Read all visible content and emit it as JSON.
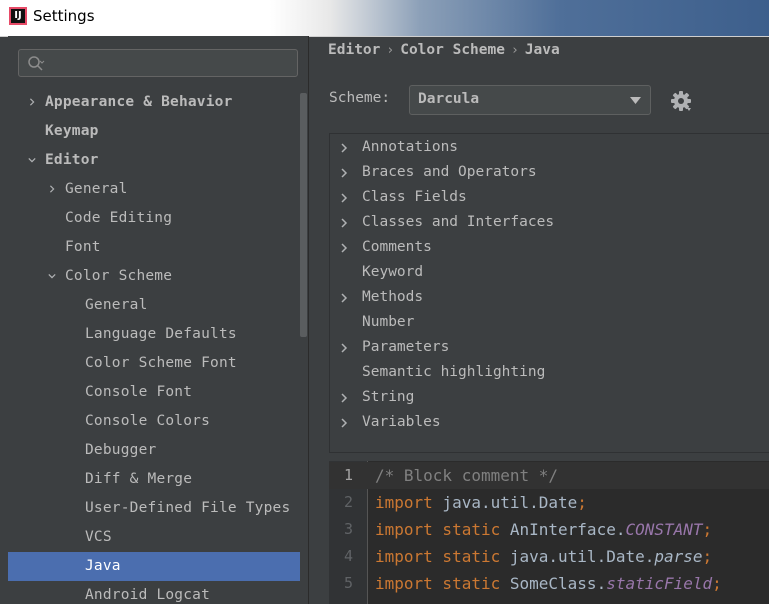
{
  "window": {
    "title": "Settings",
    "app_icon_text": "IJ"
  },
  "sidebar": {
    "search_placeholder": "",
    "items": [
      {
        "label": "Appearance & Behavior",
        "bold": true,
        "arrow": "right",
        "level": 0
      },
      {
        "label": "Keymap",
        "bold": true,
        "arrow": "none",
        "level": 0
      },
      {
        "label": "Editor",
        "bold": true,
        "arrow": "down",
        "level": 0
      },
      {
        "label": "General",
        "bold": false,
        "arrow": "right",
        "level": 1
      },
      {
        "label": "Code Editing",
        "bold": false,
        "arrow": "none",
        "level": 1
      },
      {
        "label": "Font",
        "bold": false,
        "arrow": "none",
        "level": 1
      },
      {
        "label": "Color Scheme",
        "bold": false,
        "arrow": "down",
        "level": 1
      },
      {
        "label": "General",
        "bold": false,
        "arrow": "none",
        "level": 2
      },
      {
        "label": "Language Defaults",
        "bold": false,
        "arrow": "none",
        "level": 2
      },
      {
        "label": "Color Scheme Font",
        "bold": false,
        "arrow": "none",
        "level": 2
      },
      {
        "label": "Console Font",
        "bold": false,
        "arrow": "none",
        "level": 2
      },
      {
        "label": "Console Colors",
        "bold": false,
        "arrow": "none",
        "level": 2
      },
      {
        "label": "Debugger",
        "bold": false,
        "arrow": "none",
        "level": 2
      },
      {
        "label": "Diff & Merge",
        "bold": false,
        "arrow": "none",
        "level": 2
      },
      {
        "label": "User-Defined File Types",
        "bold": false,
        "arrow": "none",
        "level": 2
      },
      {
        "label": "VCS",
        "bold": false,
        "arrow": "none",
        "level": 2
      },
      {
        "label": "Java",
        "bold": false,
        "arrow": "none",
        "level": 2,
        "selected": true
      },
      {
        "label": "Android Logcat",
        "bold": false,
        "arrow": "none",
        "level": 2
      }
    ]
  },
  "breadcrumb": {
    "items": [
      "Editor",
      "Color Scheme",
      "Java"
    ],
    "separator": "›"
  },
  "scheme": {
    "label": "Scheme:",
    "value": "Darcula"
  },
  "categories": [
    {
      "label": "Annotations",
      "expandable": true
    },
    {
      "label": "Braces and Operators",
      "expandable": true
    },
    {
      "label": "Class Fields",
      "expandable": true
    },
    {
      "label": "Classes and Interfaces",
      "expandable": true
    },
    {
      "label": "Comments",
      "expandable": true
    },
    {
      "label": "Keyword",
      "expandable": false
    },
    {
      "label": "Methods",
      "expandable": true
    },
    {
      "label": "Number",
      "expandable": false
    },
    {
      "label": "Parameters",
      "expandable": true
    },
    {
      "label": "Semantic highlighting",
      "expandable": false
    },
    {
      "label": "String",
      "expandable": true
    },
    {
      "label": "Variables",
      "expandable": true
    }
  ],
  "code_preview": {
    "lines": [
      {
        "num": "1",
        "tokens": [
          {
            "t": "/* Block comment */",
            "c": "comment"
          }
        ]
      },
      {
        "num": "2",
        "tokens": [
          {
            "t": "import",
            "c": "keyword"
          },
          {
            "t": " java.util.Date",
            "c": "plain"
          },
          {
            "t": ";",
            "c": "punct"
          }
        ]
      },
      {
        "num": "3",
        "tokens": [
          {
            "t": "import static",
            "c": "keyword"
          },
          {
            "t": " AnInterface.",
            "c": "plain"
          },
          {
            "t": "CONSTANT",
            "c": "const"
          },
          {
            "t": ";",
            "c": "punct"
          }
        ]
      },
      {
        "num": "4",
        "tokens": [
          {
            "t": "import static",
            "c": "keyword"
          },
          {
            "t": " java.util.Date.",
            "c": "plain"
          },
          {
            "t": "parse",
            "c": "static-method"
          },
          {
            "t": ";",
            "c": "punct"
          }
        ]
      },
      {
        "num": "5",
        "tokens": [
          {
            "t": "import static",
            "c": "keyword"
          },
          {
            "t": " SomeClass.",
            "c": "plain"
          },
          {
            "t": "staticField",
            "c": "const"
          },
          {
            "t": ";",
            "c": "punct"
          }
        ]
      }
    ]
  },
  "colors": {
    "background": "#3c3f41",
    "selection": "#4b6eaf",
    "editor_background": "#2b2b2b",
    "keyword": "#cc7832",
    "comment": "#808080",
    "constant": "#9876aa",
    "plain": "#a9b7c6"
  },
  "icons": {
    "search": "search-icon",
    "dropdown": "chevron-down-icon",
    "gear": "gear-icon",
    "tree_collapsed": "chevron-right-icon",
    "tree_expanded": "chevron-down-icon"
  }
}
